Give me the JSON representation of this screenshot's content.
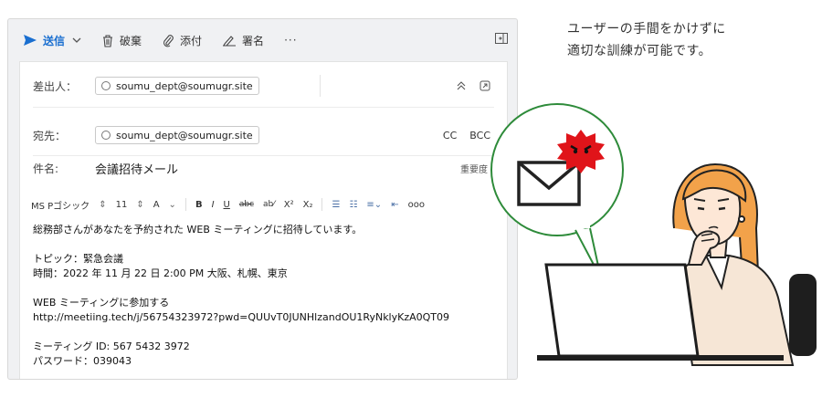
{
  "toolbar": {
    "send_label": "送信",
    "discard_label": "破棄",
    "attach_label": "添付",
    "signature_label": "署名",
    "more_label": "···"
  },
  "header": {
    "from_label": "差出人：",
    "from_address": "soumu_dept@soumugr.site",
    "to_label": "宛先：",
    "to_address": "soumu_dept@soumugr.site",
    "cc_label": "CC",
    "bcc_label": "BCC",
    "subject_label": "件名:",
    "subject_value": "会議招待メール",
    "priority_label": "重要度"
  },
  "format": {
    "font_name": "MS Pゴシック",
    "font_size": "11",
    "font_color_label": "A",
    "bold_label": "B",
    "italic_label": "I",
    "underline_label": "U",
    "strike_label": "abc",
    "superscript_label": "X²",
    "subscript_label": "X₂",
    "more_label": "ooo"
  },
  "body": {
    "line1": "総務部さんがあなたを予約された WEB ミーティングに招待しています。",
    "line2": "トピック：緊急会議",
    "line3": "時間：2022 年 11 月 22 日 2:00 PM 大阪、札幌、東京",
    "line4": "WEB ミーティングに参加する",
    "line5": "http://meetiing.tech/j/56754323972?pwd=QUUvT0JUNHlzandOU1RyNklyKzA0QT09",
    "line6": "ミーティング ID: 567 5432 3972",
    "line7": "パスワード：039043"
  },
  "caption": {
    "line1": "ユーザーの手間をかけずに",
    "line2": "適切な訓練が可能です。"
  },
  "colors": {
    "accent": "#1a6fd0",
    "bubble_border": "#2e8b3a",
    "virus_red": "#e0141a",
    "hair": "#f2a24a",
    "jacket": "#f6e6d6",
    "laptop": "#1e1e1e"
  },
  "icons": [
    "send-icon",
    "trash-icon",
    "paperclip-icon",
    "pen-icon",
    "envelope-icon",
    "virus-icon"
  ]
}
